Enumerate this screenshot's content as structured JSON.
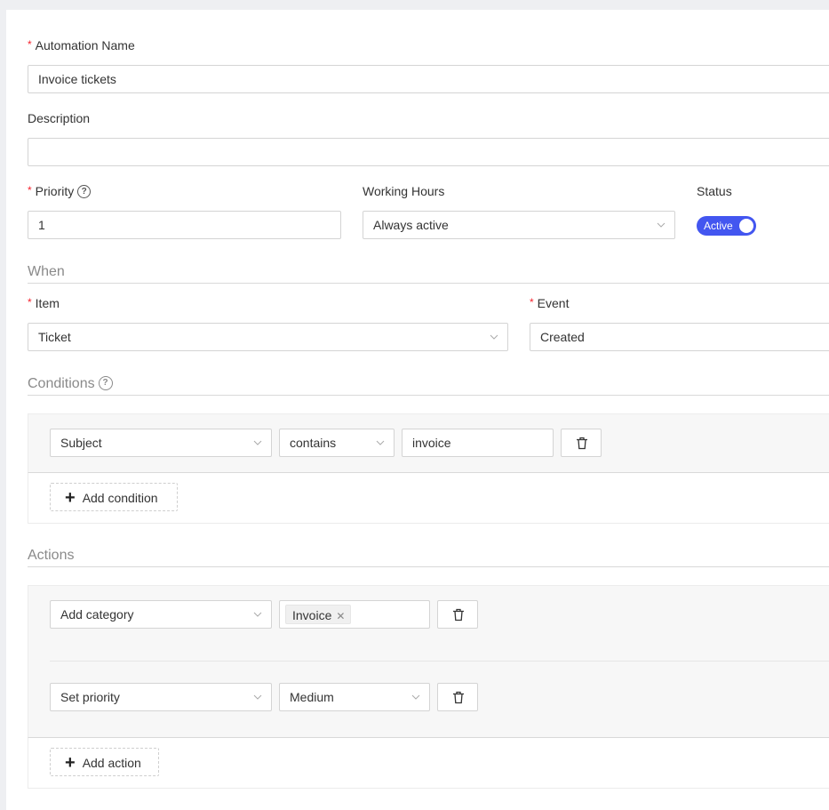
{
  "form": {
    "automation_name": {
      "label": "Automation Name",
      "required": true,
      "value": "Invoice tickets"
    },
    "description": {
      "label": "Description",
      "required": false,
      "value": ""
    },
    "priority": {
      "label": "Priority",
      "required": true,
      "value": "1",
      "help_icon": "question-circle-icon"
    },
    "working_hours": {
      "label": "Working Hours",
      "value": "Always active"
    },
    "status": {
      "label": "Status",
      "toggle_text": "Active",
      "enabled": true,
      "color": "#4356f0"
    }
  },
  "when": {
    "title": "When",
    "item": {
      "label": "Item",
      "required": true,
      "value": "Ticket"
    },
    "event": {
      "label": "Event",
      "required": true,
      "value": "Created"
    }
  },
  "conditions": {
    "title": "Conditions",
    "help_icon": "question-circle-icon",
    "rows": [
      {
        "field": "Subject",
        "operator": "contains",
        "value": "invoice"
      }
    ],
    "add_label": "Add condition"
  },
  "actions": {
    "title": "Actions",
    "rows": [
      {
        "action": "Add category",
        "tags": [
          "Invoice"
        ]
      },
      {
        "action": "Set priority",
        "value": "Medium"
      }
    ],
    "add_label": "Add action"
  }
}
